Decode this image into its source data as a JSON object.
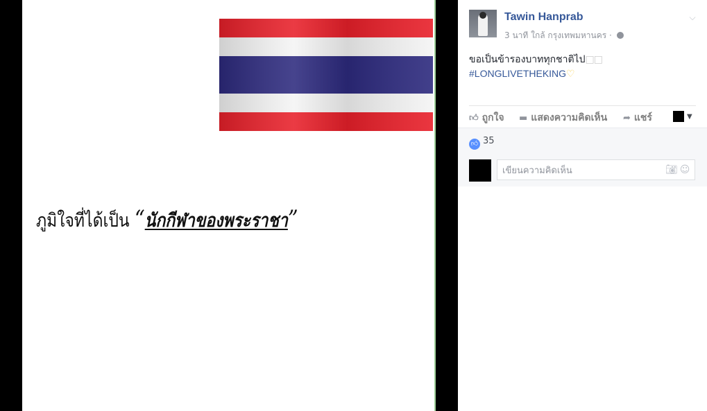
{
  "photo": {
    "caption_prefix": "ภูมิใจที่ได้เป็น",
    "quote_open": "“",
    "caption_emphasis": "นักกีฬาของพระราชา",
    "quote_close": "”",
    "flag_colors": [
      "#e8202a",
      "#ffffff",
      "#2d2a7e"
    ]
  },
  "post": {
    "author": "Tawin Hanprab",
    "time": "3 นาที",
    "location": "ใกล้ กรุงเทพมหานคร",
    "meta_separator": "·",
    "text_line1": "ขอเป็นข้ารองบาททุกชาติไป",
    "glyph_boxes": "□□",
    "hashtag": "#LONGLIVETHEKING",
    "heart": "♡"
  },
  "actions": {
    "like": "ถูกใจ",
    "comment": "แสดงความคิดเห็น",
    "share": "แชร์"
  },
  "feedback": {
    "like_count": "35",
    "comment_placeholder": "เขียนความคิดเห็น"
  },
  "icons": {
    "like": "thumbs-up-icon",
    "comment": "speech-bubble-icon",
    "share": "share-arrow-icon",
    "camera": "camera-icon",
    "smiley": "smiley-icon",
    "globe": "globe-icon",
    "chevron": "chevron-down-icon"
  }
}
